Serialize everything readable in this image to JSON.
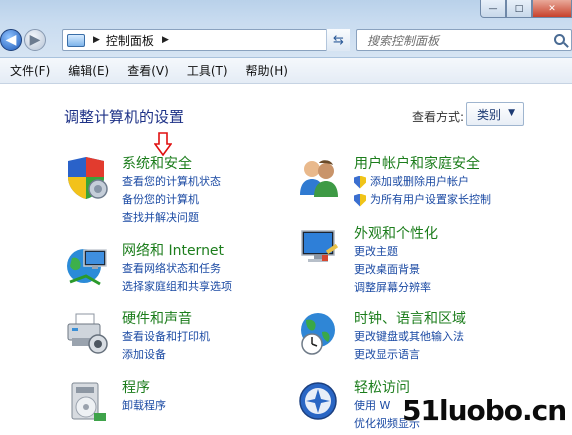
{
  "window": {
    "minimize_label": "—",
    "maximize_label": "□",
    "close_label": "✕"
  },
  "address_bar": {
    "back_label": "◀",
    "forward_label": "▶",
    "breadcrumb_sep": "▶",
    "path": "控制面板",
    "path_sep": "▶",
    "dropdown": "▼",
    "refresh": "⇆"
  },
  "search": {
    "placeholder": "搜索控制面板"
  },
  "menu": {
    "items": [
      "文件(F)",
      "编辑(E)",
      "查看(V)",
      "工具(T)",
      "帮助(H)"
    ]
  },
  "main": {
    "title": "调整计算机的设置",
    "view_by_label": "查看方式:",
    "view_by_value": "类别",
    "view_by_chevron": "▼"
  },
  "categories": {
    "system": {
      "icon": "shield-icon",
      "title": "系统和安全",
      "links": [
        "查看您的计算机状态",
        "备份您的计算机",
        "查找并解决问题"
      ]
    },
    "network": {
      "icon": "network-globe-icon",
      "title": "网络和 Internet",
      "links": [
        "查看网络状态和任务",
        "选择家庭组和共享选项"
      ]
    },
    "hardware": {
      "icon": "printer-icon",
      "title": "硬件和声音",
      "links": [
        "查看设备和打印机",
        "添加设备"
      ]
    },
    "programs": {
      "icon": "programs-icon",
      "title": "程序",
      "links": [
        "卸载程序"
      ]
    },
    "users": {
      "icon": "users-icon",
      "title": "用户帐户和家庭安全",
      "links": [
        "添加或删除用户帐户",
        "为所有用户设置家长控制"
      ]
    },
    "appearance": {
      "icon": "monitor-paint-icon",
      "title": "外观和个性化",
      "links": [
        "更改主题",
        "更改桌面背景",
        "调整屏幕分辨率"
      ]
    },
    "clock": {
      "icon": "clock-globe-icon",
      "title": "时钟、语言和区域",
      "links": [
        "更改键盘或其他输入法",
        "更改显示语言"
      ]
    },
    "ease": {
      "icon": "ease-of-access-icon",
      "title": "轻松访问",
      "links": [
        "使用 W",
        "优化视频显示"
      ]
    }
  },
  "watermark": "51luobo.cn",
  "colors": {
    "category_title": "#1c7d1c",
    "link": "#1b4aa3",
    "page_title": "#1e3287"
  }
}
